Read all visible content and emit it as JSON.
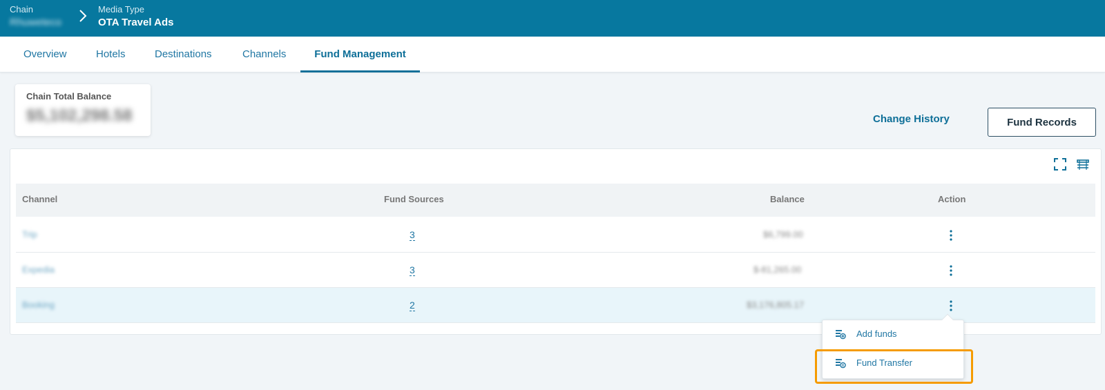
{
  "header": {
    "chain_label": "Chain",
    "chain_value": "Rhuweteco",
    "media_label": "Media Type",
    "media_value": "OTA Travel Ads"
  },
  "tabs": [
    {
      "label": "Overview"
    },
    {
      "label": "Hotels"
    },
    {
      "label": "Destinations"
    },
    {
      "label": "Channels"
    },
    {
      "label": "Fund Management",
      "active": true
    }
  ],
  "balance": {
    "label": "Chain Total Balance",
    "value": "$5,102,298.58"
  },
  "actions": {
    "change_history": "Change History",
    "fund_records": "Fund Records"
  },
  "table": {
    "headers": {
      "channel": "Channel",
      "fund_sources": "Fund Sources",
      "balance": "Balance",
      "action": "Action"
    },
    "rows": [
      {
        "channel": "Trip",
        "fund_sources": "3",
        "balance": "$6,799.00"
      },
      {
        "channel": "Expedia",
        "fund_sources": "3",
        "balance": "$-81,265.00"
      },
      {
        "channel": "Booking",
        "fund_sources": "2",
        "balance": "$3,176,805.17",
        "selected": true
      }
    ]
  },
  "menu": {
    "add_funds": "Add funds",
    "fund_transfer": "Fund Transfer"
  },
  "icons": {
    "expand": "fullscreen-icon",
    "density": "row-density-icon",
    "kebab": "more-vertical-icon"
  },
  "colors": {
    "header_bg": "#07789f",
    "accent": "#0e6f98",
    "highlight": "#f59b00"
  }
}
